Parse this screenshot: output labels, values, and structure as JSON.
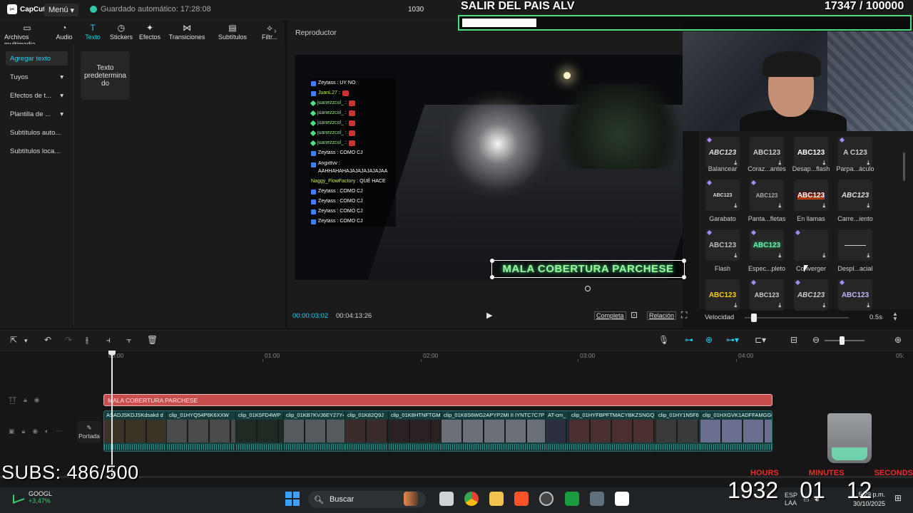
{
  "app": {
    "logo": "CapCut",
    "menu_label": "Menú",
    "autosave": "Guardado automático: 17:28:08",
    "project_name": "1030"
  },
  "tool_tabs": [
    {
      "label": "Archivos multimedia",
      "icon": "▭"
    },
    {
      "label": "Audio",
      "icon": "◔"
    },
    {
      "label": "Texto",
      "icon": "T"
    },
    {
      "label": "Stickers",
      "icon": "◷"
    },
    {
      "label": "Efectos",
      "icon": "✦"
    },
    {
      "label": "Transiciones",
      "icon": "⋈"
    },
    {
      "label": "Subtítulos",
      "icon": "▤"
    },
    {
      "label": "Filtr...",
      "icon": "⟡"
    }
  ],
  "sidebar": {
    "items": [
      {
        "label": "Agregar texto",
        "chevron": ""
      },
      {
        "label": "Tuyos",
        "chevron": "▾"
      },
      {
        "label": "Efectos de t...",
        "chevron": "▾"
      },
      {
        "label": "Plantilla de ...",
        "chevron": "▾"
      },
      {
        "label": "Subtítulos auto...",
        "chevron": ""
      },
      {
        "label": "Subtítulos loca...",
        "chevron": ""
      }
    ]
  },
  "content": {
    "default_text_card": "Texto predetermina do"
  },
  "player": {
    "title": "Reproductor",
    "time_current": "00:00:03:02",
    "time_total": "00:04:13:26",
    "completa": "Completa",
    "ratio": "Relación",
    "overlay_text": "MALA COBERTURA PARCHESE"
  },
  "chat": [
    {
      "type": "b",
      "name": "Zeytass",
      "color": "white",
      "msg": ": UY NO"
    },
    {
      "type": "b",
      "name": "JuanL27",
      "color": "lime",
      "msg": ":",
      "emote": true
    },
    {
      "type": "g",
      "name": "juanezzcol_",
      "color": "green",
      "msg": ":",
      "emote": true
    },
    {
      "type": "g",
      "name": "juanezzcol_",
      "color": "green",
      "msg": ":",
      "emote": true
    },
    {
      "type": "g",
      "name": "juanezzcol_",
      "color": "green",
      "msg": ":",
      "emote": true
    },
    {
      "type": "g",
      "name": "juanezzcol_",
      "color": "green",
      "msg": ":",
      "emote": true
    },
    {
      "type": "g",
      "name": "juanezzcol_",
      "color": "green",
      "msg": ":",
      "emote": true
    },
    {
      "type": "b",
      "name": "Zeytass",
      "color": "white",
      "msg": ": COMO CJ"
    },
    {
      "type": "b",
      "name": "Angxttvv",
      "color": "white",
      "msg": ": AAHHAHAHAJAJAJAJAJAJAA",
      "wrap": true
    },
    {
      "type": "n",
      "name": "Naggy_FlowFactory",
      "color": "lime",
      "msg": ": QUÉ HACE"
    },
    {
      "type": "b",
      "name": "Zeytass",
      "color": "white",
      "msg": ": COMO CJ"
    },
    {
      "type": "b",
      "name": "Zeytass",
      "color": "white",
      "msg": ": COMO CJ"
    },
    {
      "type": "b",
      "name": "Zeytass",
      "color": "white",
      "msg": ": COMO CJ"
    },
    {
      "type": "b",
      "name": "Zeytass",
      "color": "white",
      "msg": ": COMO CJ"
    }
  ],
  "stream": {
    "title": "SALIR DEL PAIS ALV",
    "count": "17347  / 100000",
    "progress": 0.17347,
    "subs": "SUBS: 486/500"
  },
  "effects": {
    "items": [
      {
        "preview": "ABC123",
        "label": "Balancear",
        "premium": true
      },
      {
        "preview": "ABC123",
        "label": "Coraz...antes",
        "premium": false
      },
      {
        "preview": "ABC123",
        "label": "Desap...flash",
        "premium": false
      },
      {
        "preview": "A  C123",
        "label": "Parpa...áculo",
        "premium": true
      },
      {
        "preview": "ABC123",
        "label": "Garabato",
        "premium": true
      },
      {
        "preview": "ABC123",
        "label": "Panta...fletas",
        "premium": true
      },
      {
        "preview": "ABC123",
        "label": "En llamas",
        "premium": false
      },
      {
        "preview": "ABC123",
        "label": "Carre...iento",
        "premium": false
      },
      {
        "preview": "ABC123",
        "label": "Flash",
        "premium": true
      },
      {
        "preview": "ABC123",
        "label": "Espec...pleto",
        "premium": true
      },
      {
        "preview": "",
        "label": "Converger",
        "premium": true
      },
      {
        "preview": "———",
        "label": "Despl...acial",
        "premium": false
      },
      {
        "preview": "ABC123",
        "label": "",
        "premium": false
      },
      {
        "preview": "ABC123",
        "label": "",
        "premium": true
      },
      {
        "preview": "ABC123",
        "label": "",
        "premium": true
      },
      {
        "preview": "ABC123",
        "label": "",
        "premium": true
      }
    ],
    "speed_label": "Velocidad",
    "speed_value": "0.5s"
  },
  "timeline": {
    "ruler": [
      "00:00",
      "01:00",
      "02:00",
      "03:00",
      "04:00",
      "05:"
    ],
    "text_clip": "MALA COBERTURA PARCHESE",
    "cover_label": "Portada",
    "clips": [
      "ASADJSKDJSKdsakd d",
      "clip_01HYQ54P6K6XXW",
      "clip_01K5FD4WP",
      "clip_01KB7KVJ6EY27Y4",
      "clip_01K82Q9J",
      "clip_01K8HTNFTGM",
      "clip_01K8S6WG2APYP2MI II IYNTC7C7P",
      "AT-cm_",
      "clip_01HYFBPFTMACYBKZSNGQ",
      "clip_01HY1N5F6",
      "clip_01HXGVK1ADFFAMGG0"
    ]
  },
  "stream_timer": {
    "labels": [
      "HOURS",
      "MINUTES",
      "SECONDS"
    ],
    "hours": "1932",
    "minutes": "01",
    "seconds": "12"
  },
  "taskbar": {
    "stock_name": "GOOGL",
    "stock_change": "+3,47%",
    "search": "Buscar",
    "tray_lang": "ESP",
    "tray_lang2": "LAA",
    "time": "5:29 p.m.",
    "date": "30/10/2025"
  }
}
